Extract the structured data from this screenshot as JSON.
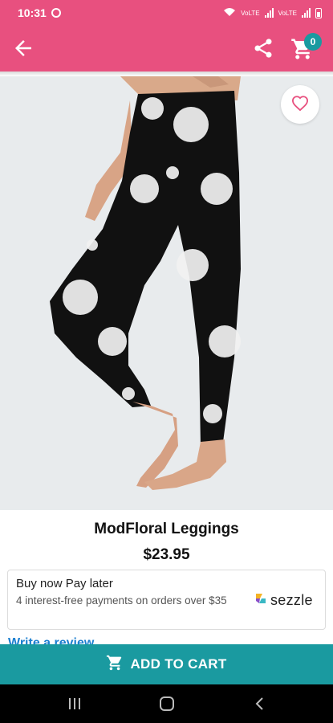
{
  "status_bar": {
    "time": "10:31",
    "signal_label_1": "VoLTE",
    "signal_label_2": "VoLTE"
  },
  "app_bar": {
    "color": "#e8507f",
    "cart_count": "0"
  },
  "product": {
    "name": "ModFloral Leggings",
    "price": "$23.95"
  },
  "bnpl": {
    "title": "Buy now Pay later",
    "description": "4 interest-free payments on orders over $35",
    "brand": "sezzle"
  },
  "review": {
    "link_text": "Write a review"
  },
  "cta": {
    "label": "ADD TO CART",
    "color": "#1a9aa0"
  },
  "icons": [
    "back-arrow-icon",
    "share-icon",
    "cart-icon",
    "heart-icon",
    "cart-icon",
    "recents-icon",
    "home-icon",
    "back-icon"
  ]
}
